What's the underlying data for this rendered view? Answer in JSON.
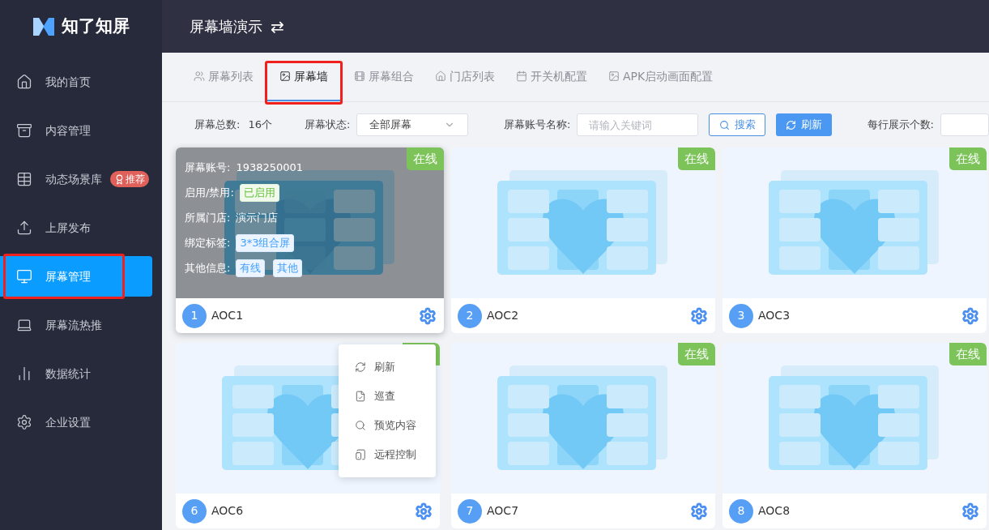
{
  "app": {
    "logo_text": "知了知屏"
  },
  "sidebar": {
    "items": [
      {
        "label": "我的首页",
        "selected": false,
        "annotated": false
      },
      {
        "label": "内容管理",
        "selected": false,
        "annotated": false
      },
      {
        "label": "动态场景库",
        "selected": false,
        "annotated": false,
        "badge": "推荐"
      },
      {
        "label": "上屏发布",
        "selected": false,
        "annotated": false
      },
      {
        "label": "屏幕管理",
        "selected": true,
        "annotated": true
      },
      {
        "label": "屏幕流热推",
        "selected": false,
        "annotated": false
      },
      {
        "label": "数据统计",
        "selected": false,
        "annotated": false
      },
      {
        "label": "企业设置",
        "selected": false,
        "annotated": false
      }
    ]
  },
  "header": {
    "title": "屏幕墙演示",
    "switch_icon": "⇄"
  },
  "tabs": [
    {
      "label": "屏幕列表",
      "selected": false,
      "annotated": false
    },
    {
      "label": "屏幕墙",
      "selected": true,
      "annotated": true
    },
    {
      "label": "屏幕组合",
      "selected": false,
      "annotated": false
    },
    {
      "label": "门店列表",
      "selected": false,
      "annotated": false
    },
    {
      "label": "开关机配置",
      "selected": false,
      "annotated": false
    },
    {
      "label": "APK启动画面配置",
      "selected": false,
      "annotated": false
    }
  ],
  "filters": {
    "total_label": "屏幕总数:",
    "total_value": "16个",
    "status_label": "屏幕状态:",
    "status_value": "全部屏幕",
    "account_label": "屏幕账号名称:",
    "account_placeholder": "请输入关键词",
    "search_button": "搜索",
    "refresh_button": "刷新",
    "per_row_label": "每行展示个数:"
  },
  "cards": [
    {
      "index": "1",
      "name": "AOC1",
      "online": true,
      "badge_label": "在线",
      "hovered": true,
      "details": [
        {
          "label": "屏幕账号:",
          "kind": "text",
          "values": [
            "1938250001"
          ]
        },
        {
          "label": "启用/禁用:",
          "kind": "success",
          "values": [
            "已启用"
          ]
        },
        {
          "label": "所属门店:",
          "kind": "text",
          "values": [
            "演示门店"
          ]
        },
        {
          "label": "绑定标签:",
          "kind": "tag",
          "values": [
            "3*3组合屏"
          ]
        },
        {
          "label": "其他信息:",
          "kind": "tag",
          "values": [
            "有线",
            "其他"
          ]
        }
      ]
    },
    {
      "index": "2",
      "name": "AOC2",
      "online": true,
      "badge_label": "在线",
      "hovered": false
    },
    {
      "index": "3",
      "name": "AOC3",
      "online": true,
      "badge_label": "在线",
      "hovered": false
    },
    {
      "index": "6",
      "name": "AOC6",
      "online": true,
      "hovered": false
    },
    {
      "index": "7",
      "name": "AOC7",
      "online": true,
      "badge_label": "在线",
      "hovered": false
    },
    {
      "index": "8",
      "name": "AOC8",
      "online": true,
      "badge_label": "在线",
      "hovered": false
    }
  ],
  "context_menu": {
    "items": [
      {
        "label": "刷新"
      },
      {
        "label": "巡查"
      },
      {
        "label": "预览内容"
      },
      {
        "label": "远程控制"
      }
    ]
  }
}
